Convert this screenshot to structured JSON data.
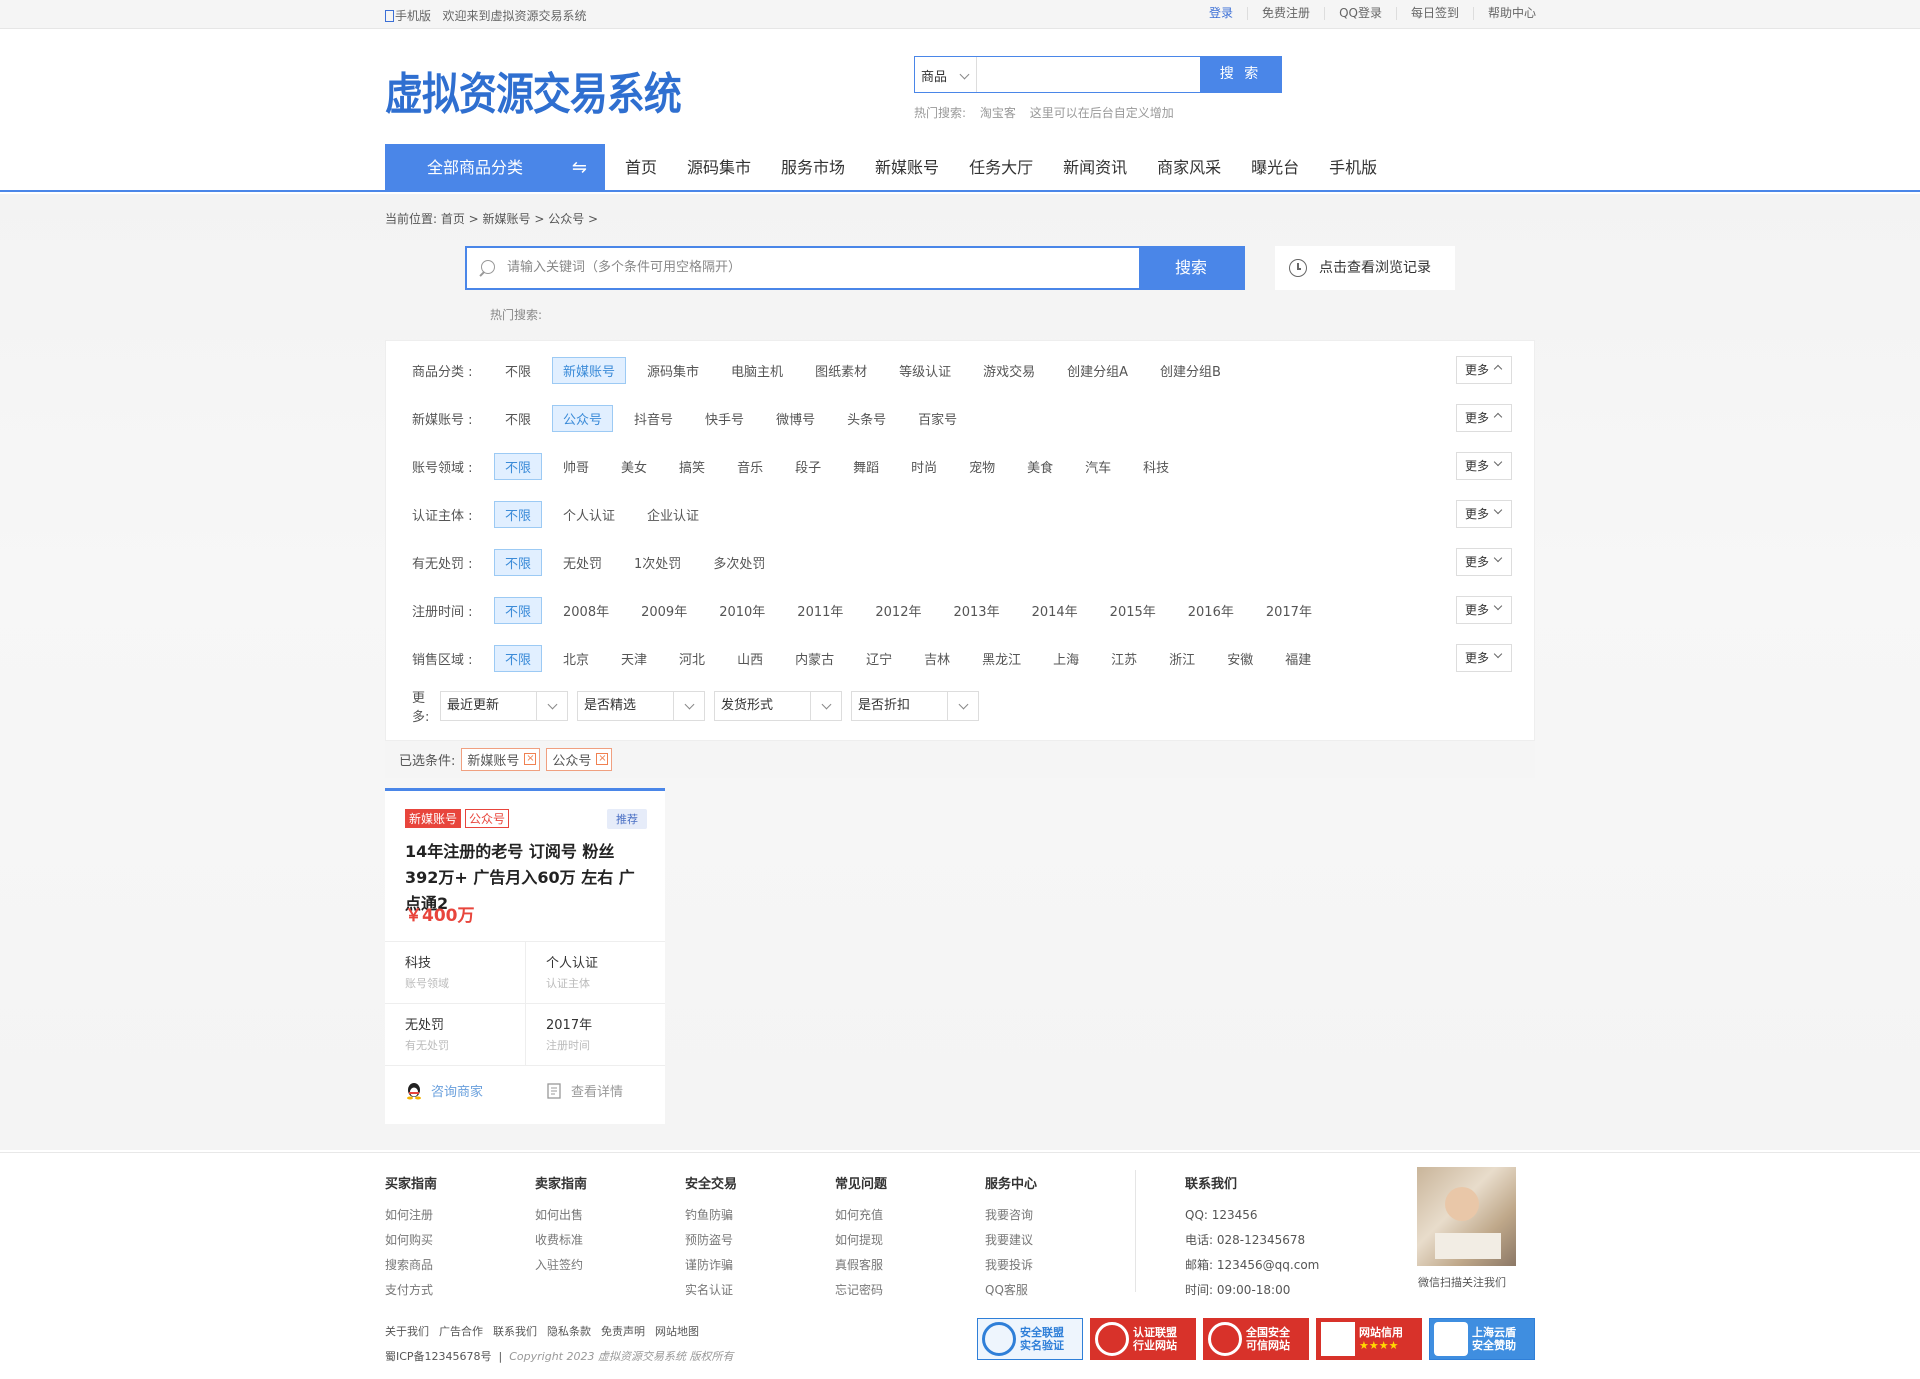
{
  "topbar": {
    "mobile": "手机版",
    "welcome": "欢迎来到虚拟资源交易系统",
    "links": [
      "登录",
      "免费注册",
      "QQ登录",
      "每日签到",
      "帮助中心"
    ]
  },
  "header": {
    "logo": "虚拟资源交易系统",
    "search_type": "商品",
    "search_button": "搜 索",
    "hot_label": "热门搜索:",
    "hot_items": [
      "淘宝客",
      "这里可以在后台自定义增加"
    ]
  },
  "nav": {
    "all_categories": "全部商品分类",
    "items": [
      "首页",
      "源码集市",
      "服务市场",
      "新媒账号",
      "任务大厅",
      "新闻资讯",
      "商家风采",
      "曝光台",
      "手机版"
    ]
  },
  "breadcrumb": "当前位置: 首页 > 新媒账号 > 公众号 >",
  "main_search": {
    "placeholder": "请输入关键词（多个条件可用空格隔开）",
    "button": "搜索",
    "history": "点击查看浏览记录",
    "hot_label": "热门搜索:"
  },
  "filters": [
    {
      "label": "商品分类 :",
      "options": [
        "不限",
        "新媒账号",
        "源码集市",
        "电脑主机",
        "图纸素材",
        "等级认证",
        "游戏交易",
        "创建分组A",
        "创建分组B"
      ],
      "selected": 1
    },
    {
      "label": "新媒账号 :",
      "options": [
        "不限",
        "公众号",
        "抖音号",
        "快手号",
        "微博号",
        "头条号",
        "百家号"
      ],
      "selected": 1
    },
    {
      "label": "账号领域 :",
      "options": [
        "不限",
        "帅哥",
        "美女",
        "搞笑",
        "音乐",
        "段子",
        "舞蹈",
        "时尚",
        "宠物",
        "美食",
        "汽车",
        "科技"
      ],
      "selected": 0
    },
    {
      "label": "认证主体 :",
      "options": [
        "不限",
        "个人认证",
        "企业认证"
      ],
      "selected": 0
    },
    {
      "label": "有无处罚 :",
      "options": [
        "不限",
        "无处罚",
        "1次处罚",
        "多次处罚"
      ],
      "selected": 0
    },
    {
      "label": "注册时间 :",
      "options": [
        "不限",
        "2008年",
        "2009年",
        "2010年",
        "2011年",
        "2012年",
        "2013年",
        "2014年",
        "2015年",
        "2016年",
        "2017年"
      ],
      "selected": 0
    },
    {
      "label": "销售区域 :",
      "options": [
        "不限",
        "北京",
        "天津",
        "河北",
        "山西",
        "内蒙古",
        "辽宁",
        "吉林",
        "黑龙江",
        "上海",
        "江苏",
        "浙江",
        "安徽",
        "福建"
      ],
      "selected": 0
    }
  ],
  "more_label": "更多",
  "dropdown_row": {
    "label": "更多:",
    "dropdowns": [
      "最近更新",
      "是否精选",
      "发货形式",
      "是否折扣"
    ]
  },
  "chosen": {
    "label": "已选条件:",
    "tags": [
      "新媒账号",
      "公众号"
    ]
  },
  "product": {
    "tag1": "新媒账号",
    "tag2": "公众号",
    "recommend": "推荐",
    "title": "14年注册的老号 订阅号 粉丝392万+ 广告月入60万 左右 广点通2",
    "price": "￥400万",
    "attrs": [
      {
        "value": "科技",
        "key": "账号领域"
      },
      {
        "value": "个人认证",
        "key": "认证主体"
      },
      {
        "value": "无处罚",
        "key": "有无处罚"
      },
      {
        "value": "2017年",
        "key": "注册时间"
      }
    ],
    "consult": "咨询商家",
    "detail": "查看详情"
  },
  "footer": {
    "columns": [
      {
        "title": "买家指南",
        "links": [
          "如何注册",
          "如何购买",
          "搜索商品",
          "支付方式"
        ]
      },
      {
        "title": "卖家指南",
        "links": [
          "如何出售",
          "收费标准",
          "入驻签约"
        ]
      },
      {
        "title": "安全交易",
        "links": [
          "钓鱼防骗",
          "预防盗号",
          "谨防诈骗",
          "实名认证"
        ]
      },
      {
        "title": "常见问题",
        "links": [
          "如何充值",
          "如何提现",
          "真假客服",
          "忘记密码"
        ]
      },
      {
        "title": "服务中心",
        "links": [
          "我要咨询",
          "我要建议",
          "我要投诉",
          "QQ客服"
        ]
      }
    ],
    "contact": {
      "title": "联系我们",
      "qq": "QQ:  123456",
      "phone": "电话:  028-12345678",
      "email": "邮箱:  123456@qq.com",
      "time": "时间:  09:00-18:00"
    },
    "qr_caption": "微信扫描关注我们",
    "bottom_links": [
      "关于我们",
      "广告合作",
      "联系我们",
      "隐私条款",
      "免责声明",
      "网站地图"
    ],
    "icp": "蜀ICP备12345678号",
    "copyright": "Copyright 2023 虚拟资源交易系统 版权所有",
    "badges": [
      {
        "line1": "安全联盟",
        "line2": "实名验证",
        "color": "#2f7fd8"
      },
      {
        "line1": "认证联盟",
        "line2": "行业网站",
        "color": "#d8322a"
      },
      {
        "line1": "全国安全",
        "line2": "可信网站",
        "color": "#d8322a"
      },
      {
        "line1": "网站信用",
        "line2": "★★★★",
        "color": "#d8322a"
      },
      {
        "line1": "上海云盾",
        "line2": "安全赞助",
        "color": "#2f7fd8"
      }
    ]
  }
}
